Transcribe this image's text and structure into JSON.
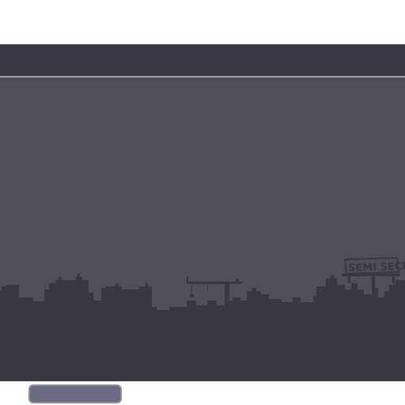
{
  "game": {
    "billboard_text": "SEMI SECRET",
    "bottom_button_label": ""
  },
  "colors": {
    "top_bar": "#373741",
    "divider": "#9e9eac",
    "sky": "#4f4f5b",
    "skyline": "#383842",
    "button": "#6a6a80"
  },
  "icons": [
    "crane-icon",
    "billboard-icon"
  ]
}
